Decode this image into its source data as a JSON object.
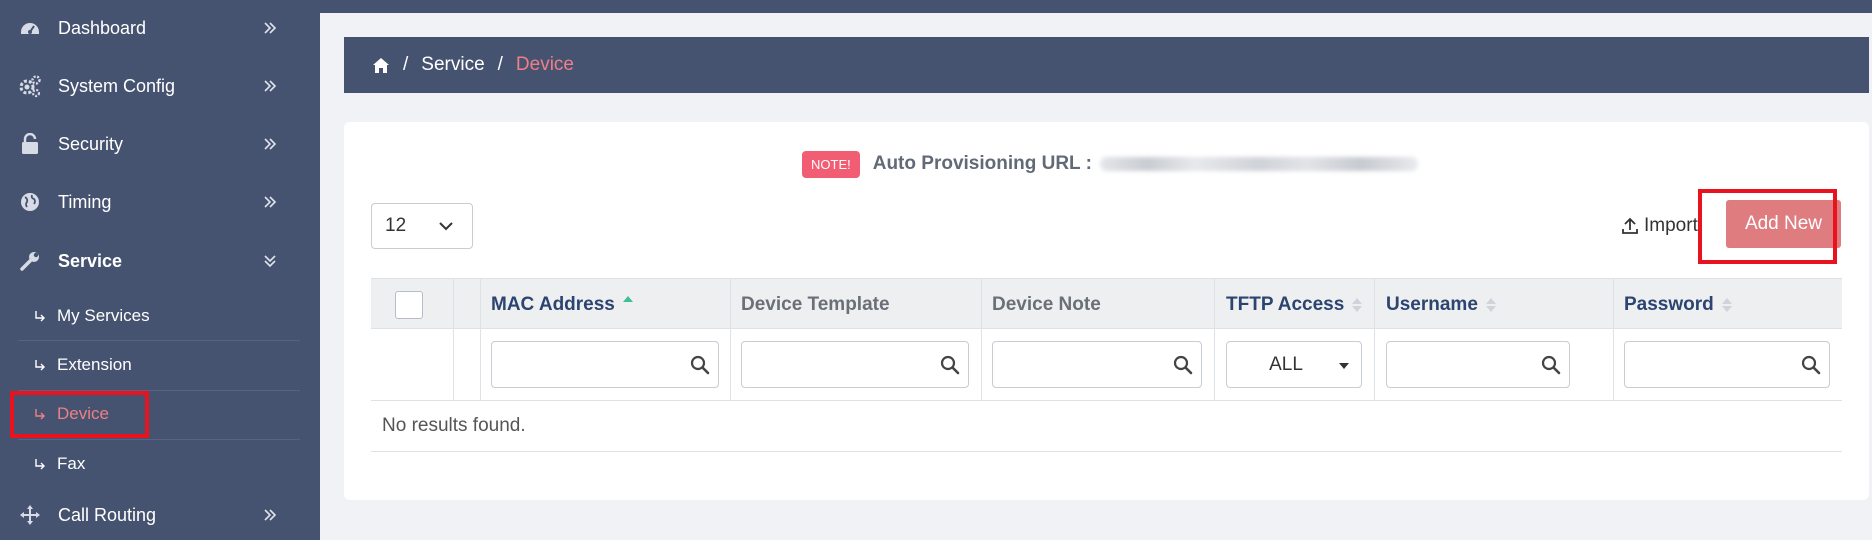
{
  "sidebar": {
    "items": [
      {
        "label": "Dashboard",
        "icon": "dashboard-icon"
      },
      {
        "label": "System Config",
        "icon": "gears-icon"
      },
      {
        "label": "Security",
        "icon": "lock-icon"
      },
      {
        "label": "Timing",
        "icon": "globe-icon"
      },
      {
        "label": "Service",
        "icon": "wrench-icon"
      },
      {
        "label": "Call Routing",
        "icon": "arrows-move-icon"
      }
    ],
    "sub_items": [
      {
        "label": "My Services"
      },
      {
        "label": "Extension"
      },
      {
        "label": "Device"
      },
      {
        "label": "Fax"
      }
    ]
  },
  "breadcrumb": {
    "home_icon": "home-icon",
    "separator": "/",
    "parent": "Service",
    "current": "Device"
  },
  "note": {
    "badge": "NOTE!",
    "text": "Auto Provisioning URL :"
  },
  "toolbar": {
    "page_size": "12",
    "import_label": "Import",
    "add_new_label": "Add New"
  },
  "table": {
    "columns": [
      {
        "label": "MAC Address",
        "sort": "asc"
      },
      {
        "label": "Device Template",
        "sort": "none"
      },
      {
        "label": "Device Note",
        "sort": "none"
      },
      {
        "label": "TFTP Access",
        "sort": "both"
      },
      {
        "label": "Username",
        "sort": "both"
      },
      {
        "label": "Password",
        "sort": "both"
      }
    ],
    "tftp_filter_value": "ALL",
    "empty_message": "No results found."
  },
  "colors": {
    "sidebar_bg": "#465370",
    "accent_pink": "#ef7f86",
    "add_new_bg": "#de7c80",
    "highlight_red": "#e8131f",
    "note_badge": "#f15e73",
    "sort_active": "#3fbf92",
    "link_header": "#2c4470"
  }
}
